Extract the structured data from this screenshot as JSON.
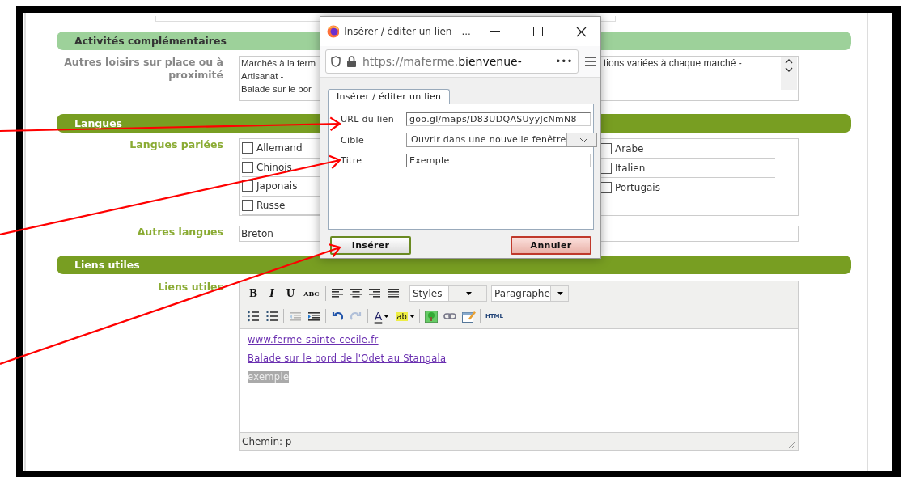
{
  "activities": {
    "title": "Activités complémentaires",
    "kind": "light",
    "label": "Autres loisirs sur place ou à proximité",
    "text_left": [
      "Marchés à la ferm",
      "Artisanat -",
      "Balade sur le bor"
    ],
    "text_right": [
      "tions variées à chaque marché -"
    ]
  },
  "languages": {
    "title": "Langues",
    "kind": "dark",
    "spoken_label": "Langues parlées",
    "options_left": [
      {
        "label": "Allemand",
        "checked": false
      },
      {
        "label": "Chinois",
        "checked": false
      },
      {
        "label": "Japonais",
        "checked": false
      },
      {
        "label": "Russe",
        "checked": false
      }
    ],
    "options_right": [
      {
        "label": "Arabe",
        "checked": false
      },
      {
        "label": "Italien",
        "checked": false
      },
      {
        "label": "Portugais",
        "checked": false
      }
    ],
    "other_label": "Autres langues",
    "other_value": "Breton"
  },
  "links": {
    "title": "Liens utiles",
    "kind": "dark",
    "label": "Liens utiles",
    "toolbar_row_1": [
      {
        "kind": "bold",
        "label": "B",
        "disabled": false
      },
      {
        "kind": "italic",
        "label": "I",
        "disabled": false
      },
      {
        "kind": "underline",
        "label": "U",
        "disabled": false
      },
      {
        "kind": "strike",
        "label": "ABC",
        "disabled": false
      },
      {
        "kind": "sep"
      },
      {
        "kind": "align-left",
        "disabled": false
      },
      {
        "kind": "align-center",
        "disabled": false
      },
      {
        "kind": "align-right",
        "disabled": false
      },
      {
        "kind": "justify",
        "disabled": false
      },
      {
        "kind": "sep"
      }
    ],
    "styles_select": "Styles",
    "format_select": "Paragraphe",
    "toolbar_row_2": [
      {
        "kind": "bullets",
        "disabled": false
      },
      {
        "kind": "numbers",
        "disabled": false
      },
      {
        "kind": "sep"
      },
      {
        "kind": "outdent",
        "disabled": true
      },
      {
        "kind": "indent",
        "disabled": false
      },
      {
        "kind": "sep"
      },
      {
        "kind": "undo",
        "disabled": false
      },
      {
        "kind": "redo",
        "disabled": true
      },
      {
        "kind": "sep"
      },
      {
        "kind": "font-color",
        "label": "A",
        "disabled": false
      },
      {
        "kind": "highlight",
        "label": "ab",
        "disabled": false
      },
      {
        "kind": "sep"
      },
      {
        "kind": "image",
        "disabled": false
      },
      {
        "kind": "link",
        "disabled": false
      },
      {
        "kind": "edit",
        "disabled": false
      },
      {
        "kind": "sep"
      },
      {
        "kind": "html",
        "label": "HTML",
        "disabled": false
      }
    ],
    "content": [
      {
        "kind": "link",
        "text": "www.ferme-sainte-cecile.fr"
      },
      {
        "kind": "link",
        "text": "Balade sur le bord de l'Odet au Stangala"
      },
      {
        "kind": "selected",
        "text": "exemple"
      }
    ],
    "path": "Chemin: p"
  },
  "dialog": {
    "title": "Insérer / éditer un lien - ...",
    "url": "https://maferme.",
    "url_domain": "bienvenue-",
    "url_more": "•••",
    "tabs": [
      {
        "label": "Insérer / éditer un lien",
        "selected": true
      }
    ],
    "fields": [
      {
        "kind": "input",
        "label": "URL du lien",
        "value": "goo.gl/maps/D83UDQASUyyJcNmN8"
      },
      {
        "kind": "select",
        "label": "Cible",
        "value": "Ouvrir dans une nouvelle fenêtre"
      },
      {
        "kind": "input",
        "label": "Titre",
        "value": "Exemple"
      }
    ],
    "buttons": [
      {
        "label": "Insérer",
        "kind": "ok"
      },
      {
        "label": "Annuler",
        "kind": "cancel"
      }
    ]
  },
  "annotations": [
    {
      "kind": "arrow"
    },
    {
      "kind": "arrow"
    },
    {
      "kind": "arrow"
    }
  ]
}
